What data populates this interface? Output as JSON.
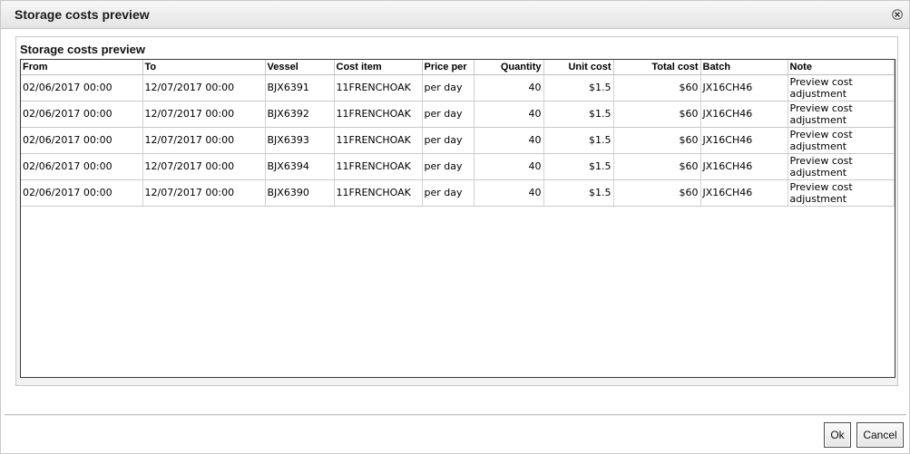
{
  "dialog": {
    "title": "Storage costs preview",
    "close_icon": "close-x-icon"
  },
  "panel": {
    "title": "Storage costs preview"
  },
  "grid": {
    "columns": [
      "From",
      "To",
      "Vessel",
      "Cost item",
      "Price per",
      "Quantity",
      "Unit cost",
      "Total cost",
      "Batch",
      "Note"
    ],
    "rows": [
      [
        "02/06/2017 00:00",
        "12/07/2017 00:00",
        "BJX6391",
        "11FRENCHOAK",
        "per day",
        "40",
        "$1.5",
        "$60",
        "JX16CH46",
        "Preview cost adjustment"
      ],
      [
        "02/06/2017 00:00",
        "12/07/2017 00:00",
        "BJX6392",
        "11FRENCHOAK",
        "per day",
        "40",
        "$1.5",
        "$60",
        "JX16CH46",
        "Preview cost adjustment"
      ],
      [
        "02/06/2017 00:00",
        "12/07/2017 00:00",
        "BJX6393",
        "11FRENCHOAK",
        "per day",
        "40",
        "$1.5",
        "$60",
        "JX16CH46",
        "Preview cost adjustment"
      ],
      [
        "02/06/2017 00:00",
        "12/07/2017 00:00",
        "BJX6394",
        "11FRENCHOAK",
        "per day",
        "40",
        "$1.5",
        "$60",
        "JX16CH46",
        "Preview cost adjustment"
      ],
      [
        "02/06/2017 00:00",
        "12/07/2017 00:00",
        "BJX6390",
        "11FRENCHOAK",
        "per day",
        "40",
        "$1.5",
        "$60",
        "JX16CH46",
        "Preview cost adjustment"
      ]
    ]
  },
  "buttons": {
    "ok": "Ok",
    "cancel": "Cancel"
  }
}
